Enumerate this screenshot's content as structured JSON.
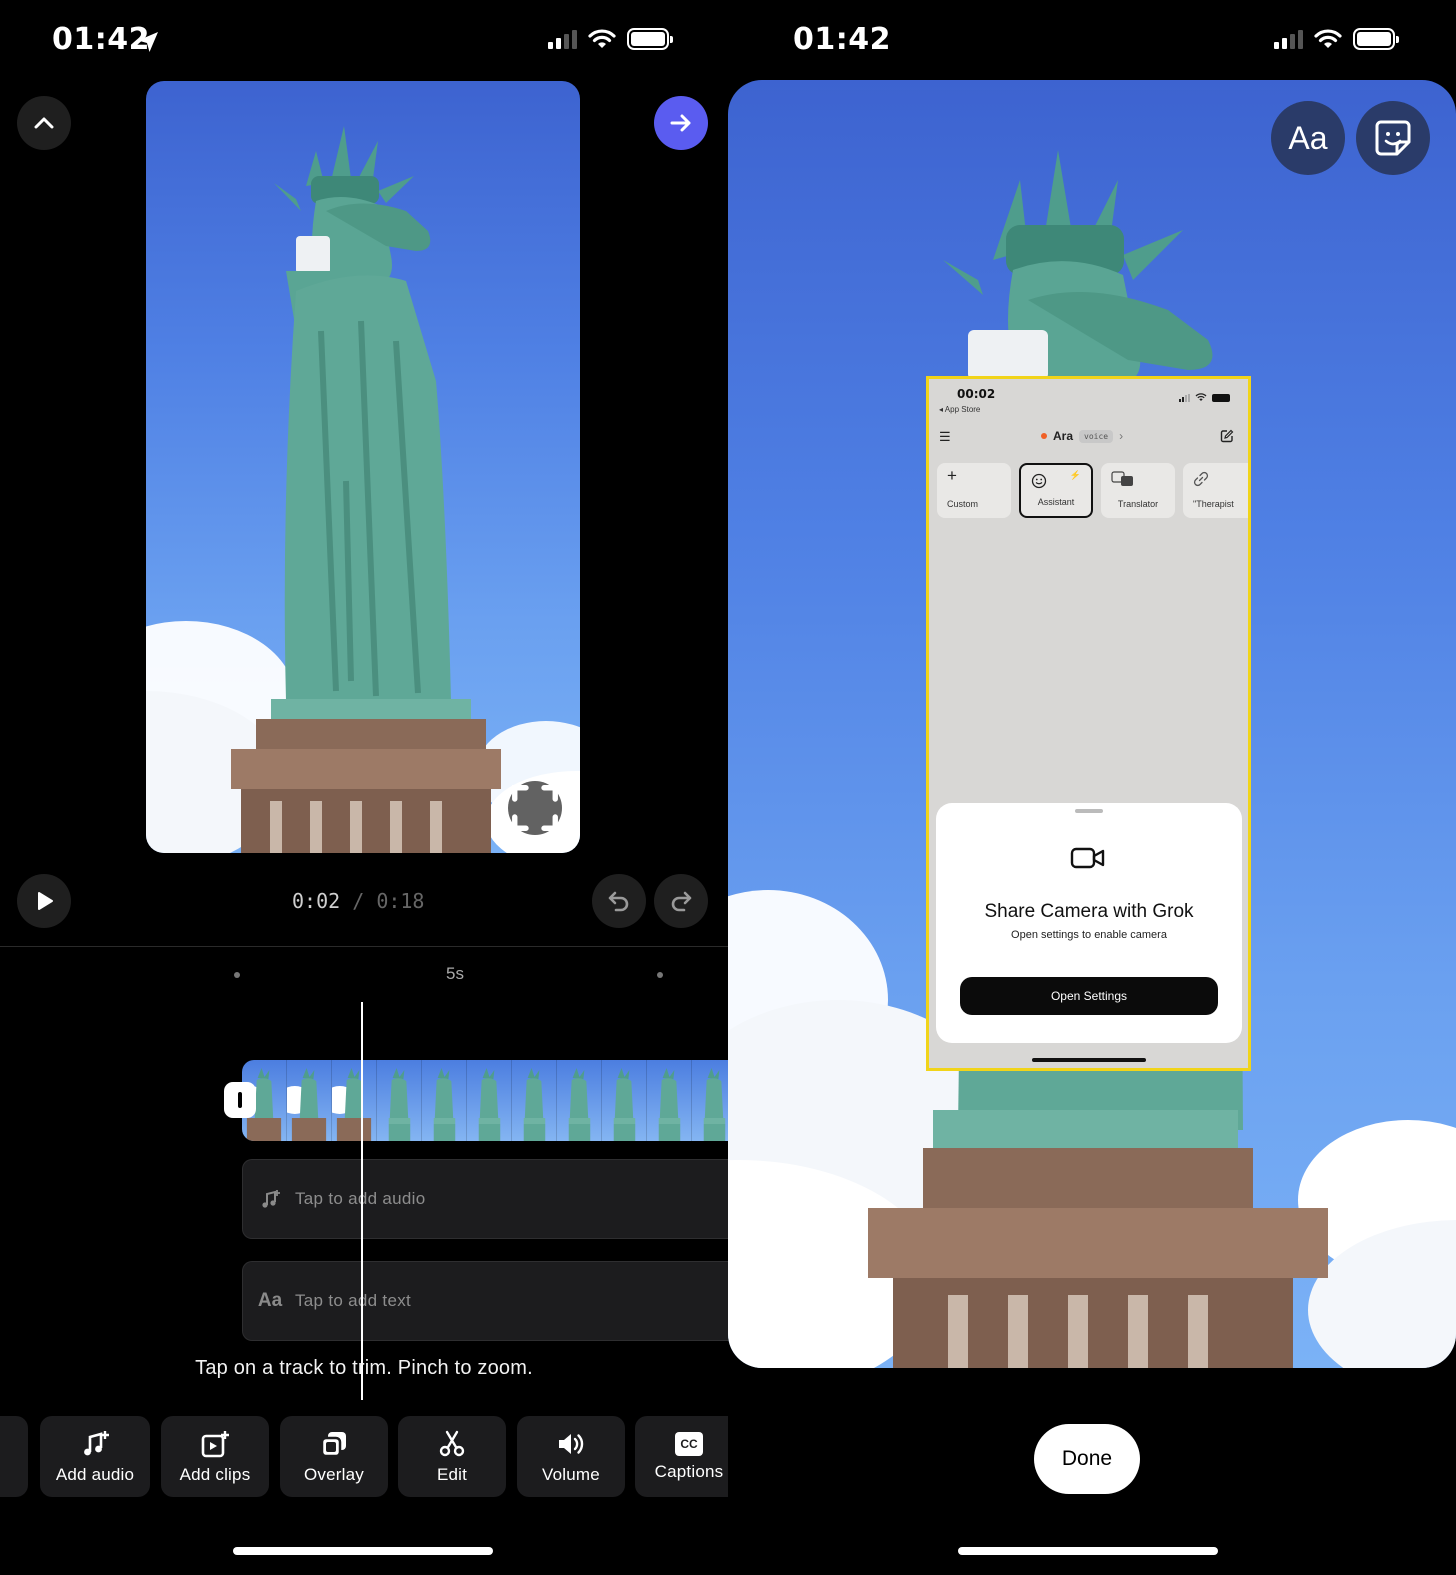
{
  "left": {
    "status": {
      "time": "01:42"
    },
    "time": {
      "current": "0:02",
      "separator": "/",
      "total": "0:18"
    },
    "ruler_label": "5s",
    "tracks": {
      "audio": "Tap to add audio",
      "text": "Tap to add text",
      "text_icon": "Aa"
    },
    "hint": "Tap on a track to trim. Pinch to zoom.",
    "tools": [
      {
        "label": "Add audio",
        "icon": "music-add-icon"
      },
      {
        "label": "Add clips",
        "icon": "clip-add-icon"
      },
      {
        "label": "Overlay",
        "icon": "overlay-icon"
      },
      {
        "label": "Edit",
        "icon": "scissors-icon"
      },
      {
        "label": "Volume",
        "icon": "speaker-icon"
      },
      {
        "label": "Captions",
        "icon": "cc-icon",
        "icon_text": "CC"
      }
    ],
    "accent": "#5a5cf0"
  },
  "right": {
    "status": {
      "time": "01:42"
    },
    "text_button": "Aa",
    "overlay": {
      "time": "00:02",
      "back": "◂ App Store",
      "title": "Ara",
      "badge": "voice",
      "chips": [
        "Custom",
        "Assistant",
        "Translator",
        "\"Therapist"
      ],
      "sheet_title": "Share Camera with Grok",
      "sheet_subtitle": "Open settings to enable camera",
      "button": "Open Settings",
      "border_color": "#f1d419"
    },
    "done": "Done"
  }
}
